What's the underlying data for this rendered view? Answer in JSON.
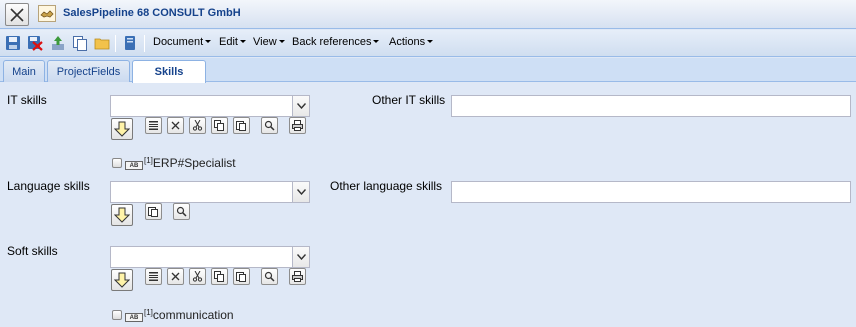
{
  "window": {
    "title": "SalesPipeline 68 CONSULT GmbH"
  },
  "toolbar": {
    "menus": {
      "document": "Document",
      "edit": "Edit",
      "view": "View",
      "back_references": "Back references",
      "actions": "Actions"
    }
  },
  "tabs": {
    "main": "Main",
    "project_fields": "ProjectFields",
    "skills": "Skills",
    "active": "Skills"
  },
  "form": {
    "it_skills": {
      "label": "IT skills",
      "value": "",
      "selected": [
        {
          "index": "[1]",
          "text": "ERP#Specialist"
        }
      ]
    },
    "other_it_skills": {
      "label": "Other IT skills",
      "value": ""
    },
    "language_skills": {
      "label": "Language skills",
      "value": ""
    },
    "other_language_skills": {
      "label": "Other language skills",
      "value": ""
    },
    "soft_skills": {
      "label": "Soft skills",
      "value": "",
      "selected": [
        {
          "index": "[1]",
          "text": "communication"
        }
      ]
    },
    "chip_type_icon": "AB"
  }
}
